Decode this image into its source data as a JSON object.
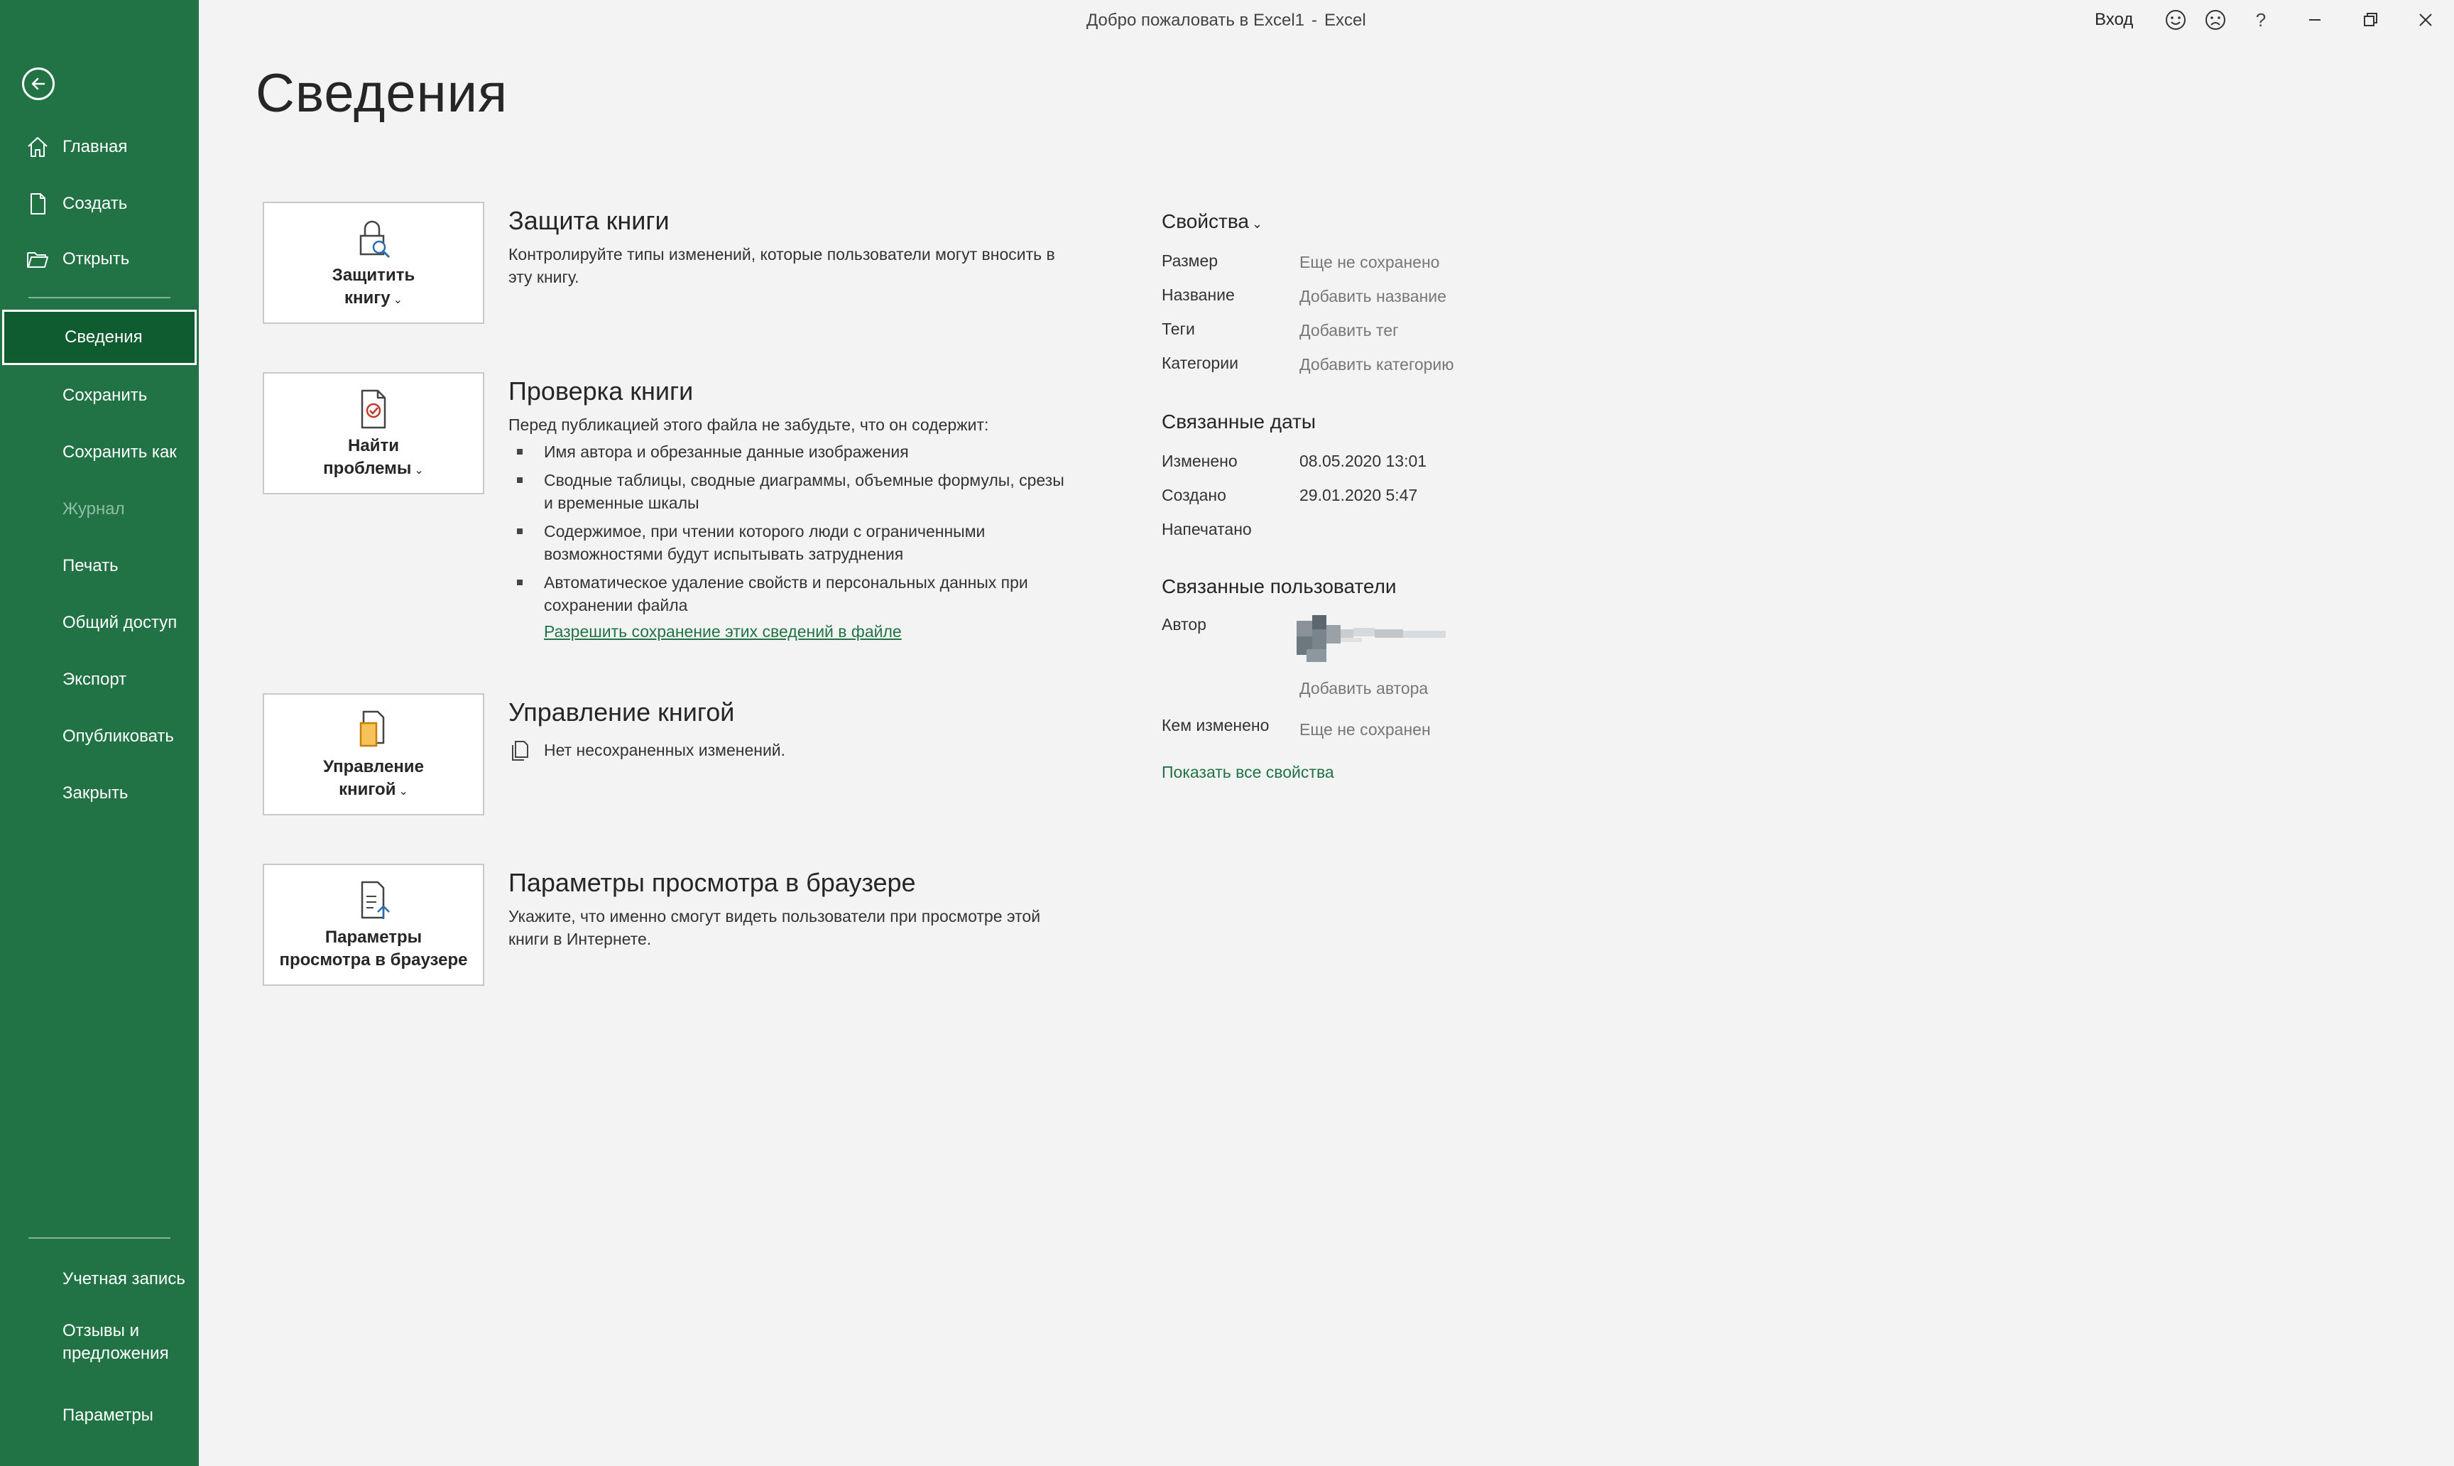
{
  "window": {
    "title": "Добро пожаловать в Excel1",
    "separator": "-",
    "app": "Excel",
    "signin": "Вход",
    "help": "?"
  },
  "sidebar": {
    "items": [
      {
        "label": "Главная",
        "icon": "home-icon"
      },
      {
        "label": "Создать",
        "icon": "new-document-icon"
      },
      {
        "label": "Открыть",
        "icon": "open-folder-icon"
      },
      {
        "label": "Сведения"
      },
      {
        "label": "Сохранить"
      },
      {
        "label": "Сохранить как"
      },
      {
        "label": "Журнал"
      },
      {
        "label": "Печать"
      },
      {
        "label": "Общий доступ"
      },
      {
        "label": "Экспорт"
      },
      {
        "label": "Опубликовать"
      },
      {
        "label": "Закрыть"
      }
    ],
    "bottom": [
      {
        "label": "Учетная запись"
      },
      {
        "label": "Отзывы и\nпредложения"
      },
      {
        "label": "Параметры"
      }
    ]
  },
  "main": {
    "title": "Сведения",
    "protect": {
      "tile": "Защитить\nкнигу",
      "title": "Защита книги",
      "desc": "Контролируйте типы изменений, которые пользователи могут вносить в эту книгу."
    },
    "inspect": {
      "tile": "Найти\nпроблемы",
      "title": "Проверка книги",
      "desc": "Перед публикацией этого файла не забудьте, что он содержит:",
      "bullets": [
        "Имя автора и обрезанные данные изображения",
        "Сводные таблицы, сводные диаграммы, объемные формулы, срезы и временные шкалы",
        "Содержимое, при чтении которого люди с ограниченными возможностями будут испытывать затруднения",
        "Автоматическое удаление свойств и персональных данных при сохранении файла"
      ],
      "link": "Разрешить сохранение этих сведений в файле"
    },
    "manage": {
      "tile": "Управление\nкнигой",
      "title": "Управление книгой",
      "status": "Нет несохраненных изменений."
    },
    "browser": {
      "tile": "Параметры\nпросмотра в браузере",
      "title": "Параметры просмотра в браузере",
      "desc": "Укажите, что именно смогут видеть пользователи при просмотре этой книги в Интернете."
    }
  },
  "properties": {
    "header": "Свойства",
    "rows": [
      {
        "label": "Размер",
        "value": "Еще не сохранено"
      },
      {
        "label": "Название",
        "value": "Добавить название"
      },
      {
        "label": "Теги",
        "value": "Добавить тег"
      },
      {
        "label": "Категории",
        "value": "Добавить категорию"
      }
    ],
    "dates_header": "Связанные даты",
    "dates": [
      {
        "label": "Изменено",
        "value": "08.05.2020 13:01"
      },
      {
        "label": "Создано",
        "value": "29.01.2020 5:47"
      },
      {
        "label": "Напечатано",
        "value": ""
      }
    ],
    "people_header": "Связанные пользователи",
    "author_label": "Автор",
    "add_author": "Добавить автора",
    "modified_by_label": "Кем изменено",
    "modified_by_value": "Еще не сохранен",
    "show_all": "Показать все свойства"
  },
  "colors": {
    "accent": "#217346",
    "active_nav": "#0e5c2f",
    "background": "#f3f3f3"
  }
}
